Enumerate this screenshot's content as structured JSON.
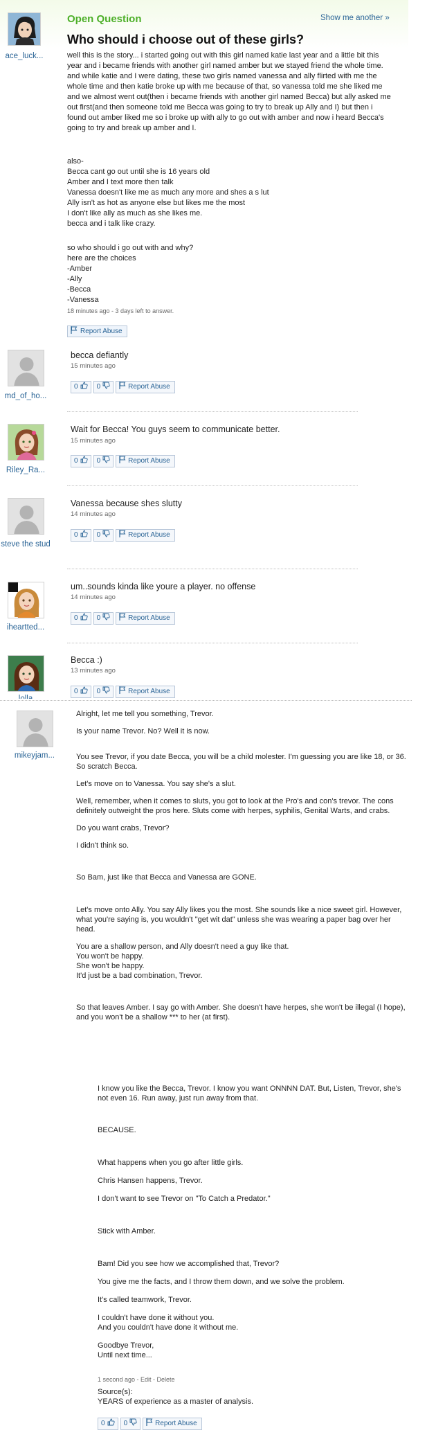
{
  "question": {
    "label": "Open Question",
    "show_another": "Show me another »",
    "title": "Who should i choose out of these girls?",
    "asker": "ace_luck...",
    "body1": "well this is the story... i started going out with this girl named katie last year and a little bit this year and i became friends with another girl named amber but we stayed friend the whole time. and while katie and I were dating, these two girls named vanessa and ally flirted with me the whole time and then katie broke up with me because of that, so vanessa told me she liked me and we almost went out(then i became friends with another girl named Becca) but ally asked me out first(and then someone told me Becca was going to try to break up Ally and I) but then i found out amber liked me so i broke up with ally to go out with amber and now i heard Becca's going to try and break up amber and I.",
    "body2": "also-\nBecca cant go out until she is 16 years old\nAmber and I text more then talk\nVanessa doesn't like me as much any more and shes a s lut\nAlly isn't as hot as anyone else but likes me the most\nI don't like ally as much as she likes me.\nbecca and i talk like crazy.",
    "body3": "so who should i go out with and why?\nhere are the choices\n-Amber\n-Ally\n-Becca\n-Vanessa",
    "meta": "18 minutes ago - 3 days left to answer.",
    "report": "Report Abuse"
  },
  "answers": [
    {
      "user": "md_of_ho...",
      "text": "becca defiantly",
      "time": "15 minutes ago",
      "up": "0",
      "down": "0",
      "report": "Report Abuse"
    },
    {
      "user": "Riley_Ra...",
      "text": "Wait for Becca! You guys seem to communicate better.",
      "time": "15 minutes ago",
      "up": "0",
      "down": "0",
      "report": "Report Abuse"
    },
    {
      "user": "steve the stud",
      "text": "Vanessa because shes slutty",
      "time": "14 minutes ago",
      "up": "0",
      "down": "0",
      "report": "Report Abuse"
    },
    {
      "user": "iheartted...",
      "text": "um..sounds kinda like youre a player. no offense",
      "time": "14 minutes ago",
      "up": "0",
      "down": "0",
      "report": "Report Abuse"
    },
    {
      "user": "lolla",
      "text": "Becca :)",
      "time": "13 minutes ago",
      "up": "0",
      "down": "0",
      "report": "Report Abuse"
    }
  ],
  "long_answer": {
    "user": "mikeyjam...",
    "paras": [
      "Alright, let me tell you something, Trevor.",
      "Is your name Trevor. No? Well it is now.",
      "You see Trevor, if you date Becca, you will be a child molester. I'm guessing you are like 18, or 36. So scratch Becca.",
      "Let's move on to Vanessa. You say she's a slut.",
      "Well, remember, when it comes to sluts, you got to look at the Pro's and con's trevor. The cons definitely outweight the pros here. Sluts come with herpes, syphilis, Genital Warts, and crabs.",
      "Do you want crabs, Trevor?",
      "I didn't think so.",
      "So Bam, just like that Becca and Vanessa are GONE.",
      "Let's move onto Ally. You say Ally likes you the most. She sounds like a nice sweet girl. However, what you're saying is, you wouldn't \"get wit dat\" unless she was wearing a paper bag over her head.",
      "You are a shallow person, and Ally doesn't need a guy like that.\nYou won't be happy.\nShe won't be happy.\nIt'd just be a bad combination, Trevor.",
      "So that leaves Amber. I say go with Amber. She doesn't have herpes, she won't be illegal (I hope), and you won't be a shallow *** to her (at first).",
      "I know you like the Becca, Trevor. I know you want ONNNN DAT. But, Listen, Trevor, she's not even 16. Run away, just run away from that.",
      "BECAUSE.",
      "What happens when you go after little girls.",
      "Chris Hansen happens, Trevor.",
      "I don't want to see Trevor on \"To Catch a Predator.\"",
      "Stick with Amber.",
      "Bam! Did you see how we accomplished that, Trevor?",
      "You give me the facts, and I throw them down, and we solve the problem.",
      "It's called teamwork, Trevor.",
      "I couldn't have done it without you.\nAnd you couldn't have done it without me.",
      "Goodbye Trevor,\nUntil next time..."
    ],
    "meta": "1 second ago - Edit - Delete",
    "source_label": "Source(s):",
    "source": "YEARS of experience as a master of analysis.",
    "up": "0",
    "down": "0",
    "report": "Report Abuse"
  },
  "colors": {
    "accent_green": "#4caf28",
    "link_blue": "#2a6496",
    "button_border": "#b7c6d9"
  }
}
